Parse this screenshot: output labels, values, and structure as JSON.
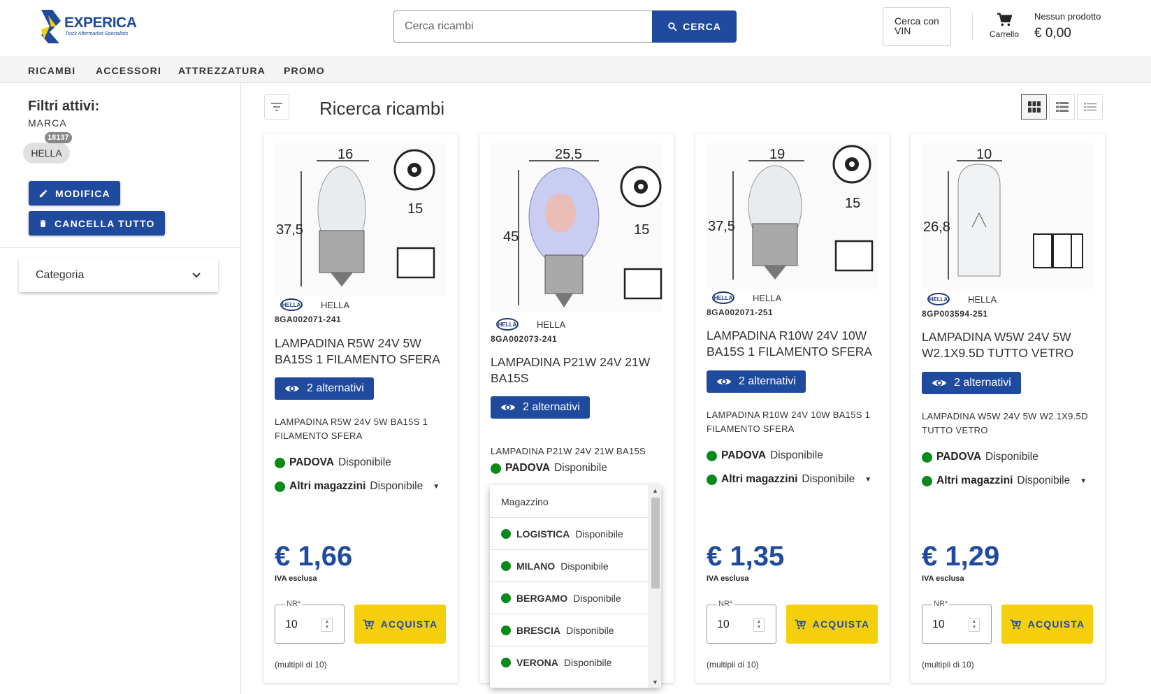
{
  "brand": {
    "name": "EXPERICA",
    "tagline": "Truck Aftermarket Specialists"
  },
  "search": {
    "placeholder": "Cerca ricambi",
    "button": "CERCA"
  },
  "vin_button": "Cerca con VIN",
  "cart": {
    "label": "Carrello",
    "status": "Nessun prodotto",
    "total": "€ 0,00"
  },
  "nav": [
    "RICAMBI",
    "ACCESSORI",
    "ATTREZZATURA",
    "PROMO"
  ],
  "sidebar": {
    "title": "Filtri attivi:",
    "marca_label": "MARCA",
    "chip": "HELLA",
    "chip_badge": "18137",
    "modify": "MODIFICA",
    "clear_all": "CANCELLA TUTTO",
    "categoria": "Categoria"
  },
  "main": {
    "title": "Ricerca ricambi"
  },
  "products": [
    {
      "brand": "HELLA",
      "code": "8GA002071-241",
      "name": "LAMPADINA R5W 24V 5W BA15S 1 FILAMENTO SFERA",
      "alternatives": "2 alternativi",
      "description": "LAMPADINA R5W 24V 5W BA15S 1 FILAMENTO SFERA",
      "stock_main_loc": "PADOVA",
      "stock_main_status": "Disponibile",
      "stock_other_loc": "Altri magazzini",
      "stock_other_status": "Disponibile",
      "price": "€ 1,66",
      "iva": "IVA esclusa",
      "qty_label": "NR*",
      "qty": "10",
      "buy": "ACQUISTA",
      "multiples": "(multipli di 10)",
      "dims": {
        "top": "16",
        "side": "37,5",
        "base": "15"
      }
    },
    {
      "brand": "HELLA",
      "code": "8GA002073-241",
      "name": "LAMPADINA P21W 24V 21W BA15S",
      "alternatives": "2 alternativi",
      "description": "LAMPADINA P21W 24V 21W BA15S",
      "stock_main_loc": "PADOVA",
      "stock_main_status": "Disponibile",
      "price": "",
      "dims": {
        "top": "25,5",
        "side": "45",
        "base": "15"
      }
    },
    {
      "brand": "HELLA",
      "code": "8GA002071-251",
      "name": "LAMPADINA R10W 24V 10W BA15S 1 FILAMENTO SFERA",
      "alternatives": "2 alternativi",
      "description": "LAMPADINA R10W 24V 10W BA15S 1 FILAMENTO SFERA",
      "stock_main_loc": "PADOVA",
      "stock_main_status": "Disponibile",
      "stock_other_loc": "Altri magazzini",
      "stock_other_status": "Disponibile",
      "price": "€ 1,35",
      "iva": "IVA esclusa",
      "qty_label": "NR*",
      "qty": "10",
      "buy": "ACQUISTA",
      "multiples": "(multipli di 10)",
      "dims": {
        "top": "19",
        "side": "37,5",
        "base": "15"
      }
    },
    {
      "brand": "HELLA",
      "code": "8GP003594-251",
      "name": "LAMPADINA W5W 24V 5W W2.1X9.5D TUTTO VETRO",
      "alternatives": "2 alternativi",
      "description": "LAMPADINA W5W 24V 5W W2.1X9.5D TUTTO VETRO",
      "stock_main_loc": "PADOVA",
      "stock_main_status": "Disponibile",
      "stock_other_loc": "Altri magazzini",
      "stock_other_status": "Disponibile",
      "price": "€ 1,29",
      "iva": "IVA esclusa",
      "qty_label": "NR*",
      "qty": "10",
      "buy": "ACQUISTA",
      "multiples": "(multipli di 10)",
      "dims": {
        "top": "10",
        "side": "26,8"
      }
    }
  ],
  "warehouse_dropdown": {
    "header": "Magazzino",
    "rows": [
      {
        "loc": "LOGISTICA",
        "status": "Disponibile"
      },
      {
        "loc": "MILANO",
        "status": "Disponibile"
      },
      {
        "loc": "BERGAMO",
        "status": "Disponibile"
      },
      {
        "loc": "BRESCIA",
        "status": "Disponibile"
      },
      {
        "loc": "VERONA",
        "status": "Disponibile"
      }
    ]
  },
  "icons": {
    "search": "search-icon",
    "cart": "cart-icon",
    "edit": "pencil-icon",
    "delete": "trash-icon",
    "chevron": "chevron-down-icon",
    "filter": "filter-icon",
    "eye": "eye-icon",
    "buy": "cart-plus-icon"
  },
  "colors": {
    "primary": "#1f4a9e",
    "accent": "#f5cf0b",
    "available": "#0a8a1a"
  }
}
